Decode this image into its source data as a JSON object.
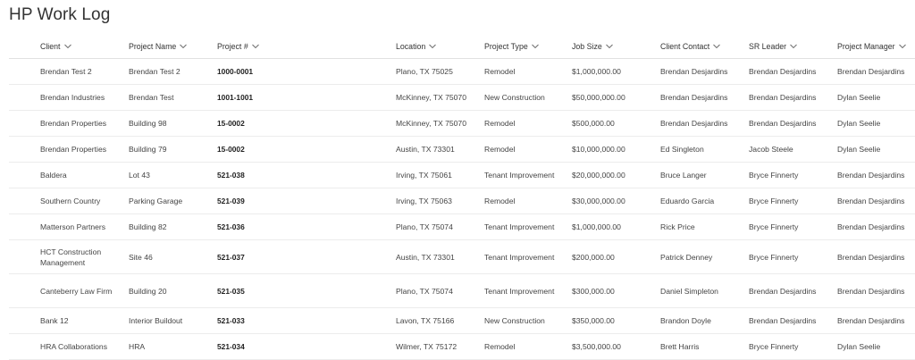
{
  "page": {
    "title": "HP Work Log"
  },
  "columns": [
    {
      "key": "client",
      "label": "Client"
    },
    {
      "key": "project_name",
      "label": "Project Name"
    },
    {
      "key": "project_num",
      "label": "Project #"
    },
    {
      "key": "location",
      "label": "Location"
    },
    {
      "key": "project_type",
      "label": "Project Type"
    },
    {
      "key": "job_size",
      "label": "Job Size"
    },
    {
      "key": "client_contact",
      "label": "Client Contact"
    },
    {
      "key": "sr_leader",
      "label": "SR Leader"
    },
    {
      "key": "project_manager",
      "label": "Project Manager"
    }
  ],
  "rows": [
    {
      "client": "Brendan Test 2",
      "project_name": "Brendan Test 2",
      "project_num": "1000-0001",
      "location": "Plano, TX 75025",
      "project_type": "Remodel",
      "job_size": "$1,000,000.00",
      "client_contact": "Brendan Desjardins",
      "sr_leader": "Brendan Desjardins",
      "project_manager": "Brendan Desjardins"
    },
    {
      "client": "Brendan Industries",
      "project_name": "Brendan Test",
      "project_num": "1001-1001",
      "location": "McKinney, TX 75070",
      "project_type": "New Construction",
      "job_size": "$50,000,000.00",
      "client_contact": "Brendan Desjardins",
      "sr_leader": "Brendan Desjardins",
      "project_manager": "Dylan Seelie"
    },
    {
      "client": "Brendan Properties",
      "project_name": "Building 98",
      "project_num": "15-0002",
      "location": "McKinney, TX 75070",
      "project_type": "Remodel",
      "job_size": "$500,000.00",
      "client_contact": "Brendan Desjardins",
      "sr_leader": "Brendan Desjardins",
      "project_manager": "Dylan Seelie"
    },
    {
      "client": "Brendan Properties",
      "project_name": "Building 79",
      "project_num": "15-0002",
      "location": "Austin, TX 73301",
      "project_type": "Remodel",
      "job_size": "$10,000,000.00",
      "client_contact": "Ed Singleton",
      "sr_leader": "Jacob Steele",
      "project_manager": "Dylan Seelie"
    },
    {
      "client": "Baldera",
      "project_name": "Lot 43",
      "project_num": "521-038",
      "location": "Irving, TX 75061",
      "project_type": "Tenant Improvement",
      "job_size": "$20,000,000.00",
      "client_contact": "Bruce Langer",
      "sr_leader": "Bryce Finnerty",
      "project_manager": "Brendan Desjardins"
    },
    {
      "client": "Southern Country",
      "project_name": "Parking Garage",
      "project_num": "521-039",
      "location": "Irving, TX 75063",
      "project_type": "Remodel",
      "job_size": "$30,000,000.00",
      "client_contact": "Eduardo Garcia",
      "sr_leader": "Bryce Finnerty",
      "project_manager": "Brendan Desjardins"
    },
    {
      "client": "Matterson Partners",
      "project_name": "Building 82",
      "project_num": "521-036",
      "location": "Plano, TX 75074",
      "project_type": "Tenant Improvement",
      "job_size": "$1,000,000.00",
      "client_contact": "Rick Price",
      "sr_leader": "Bryce Finnerty",
      "project_manager": "Brendan Desjardins"
    },
    {
      "client": "HCT Construction Management",
      "project_name": "Site 46",
      "project_num": "521-037",
      "location": "Austin, TX 73301",
      "project_type": "Tenant Improvement",
      "job_size": "$200,000.00",
      "client_contact": "Patrick Denney",
      "sr_leader": "Bryce Finnerty",
      "project_manager": "Brendan Desjardins"
    },
    {
      "client": "Canteberry Law Firm",
      "project_name": "Building 20",
      "project_num": "521-035",
      "location": "Plano, TX 75074",
      "project_type": "Tenant Improvement",
      "job_size": "$300,000.00",
      "client_contact": "Daniel Simpleton",
      "sr_leader": "Brendan Desjardins",
      "project_manager": "Brendan Desjardins"
    },
    {
      "client": "Bank 12",
      "project_name": "Interior Buildout",
      "project_num": "521-033",
      "location": "Lavon, TX 75166",
      "project_type": "New Construction",
      "job_size": "$350,000.00",
      "client_contact": "Brandon Doyle",
      "sr_leader": "Brendan Desjardins",
      "project_manager": "Brendan Desjardins"
    },
    {
      "client": "HRA Collaborations",
      "project_name": "HRA",
      "project_num": "521-034",
      "location": "Wilmer, TX 75172",
      "project_type": "Remodel",
      "job_size": "$3,500,000.00",
      "client_contact": "Brett Harris",
      "sr_leader": "Bryce Finnerty",
      "project_manager": "Dylan Seelie"
    }
  ]
}
